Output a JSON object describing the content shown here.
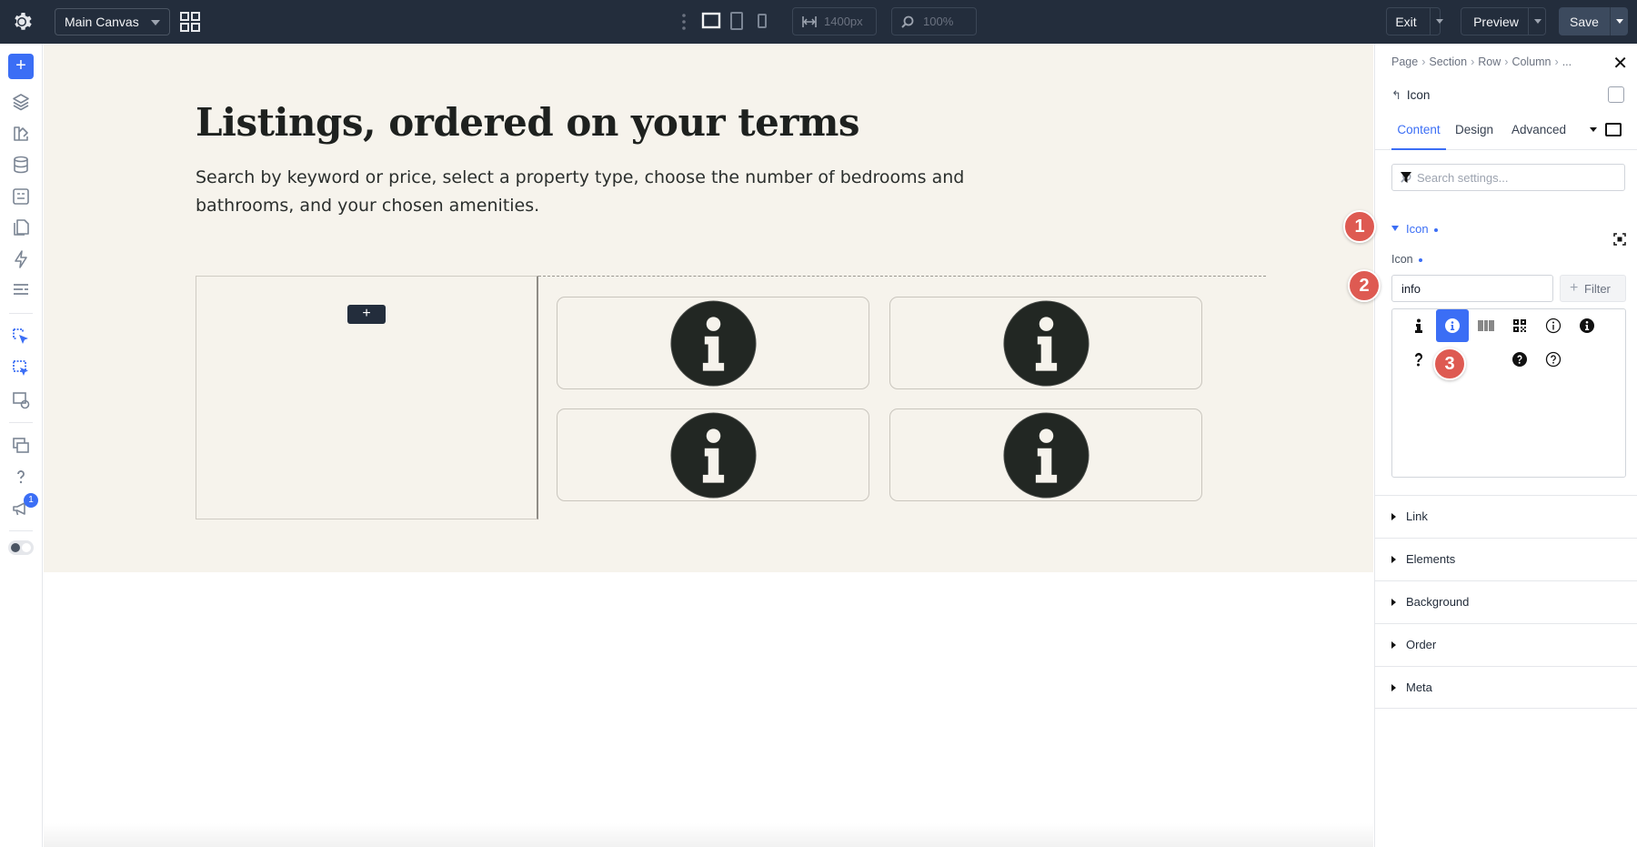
{
  "topbar": {
    "canvas_select": "Main Canvas",
    "width_value": "1400px",
    "zoom_value": "100%",
    "exit_label": "Exit",
    "preview_label": "Preview",
    "save_label": "Save"
  },
  "rail": {
    "add_label": "+",
    "notification_count": "1"
  },
  "canvas": {
    "heading": "Listings, ordered on your terms",
    "subtext": "Search by keyword or price, select a property type, choose the number of bedrooms and bathrooms, and your chosen amenities.",
    "add_label": "+",
    "card_icons": [
      "info-icon",
      "info-icon",
      "info-icon",
      "info-icon"
    ]
  },
  "panel": {
    "breadcrumb": [
      "Page",
      "Section",
      "Row",
      "Column",
      "..."
    ],
    "module_title": "Icon",
    "tabs": [
      "Content",
      "Design",
      "Advanced"
    ],
    "active_tab": "Content",
    "search_placeholder": "Search settings...",
    "open_section": "Icon",
    "field_label": "Icon",
    "field_value": "info",
    "filter_label": "Filter",
    "icon_results": [
      "info-icon",
      "info-circle-icon",
      "barcode-icon",
      "qrcode-icon",
      "info-outline-icon",
      "info-solid-icon",
      "question-icon",
      "question-circle-solid-icon",
      "question-circle-outline-icon"
    ],
    "selected_icon": "info-circle-icon",
    "sections": [
      "Link",
      "Elements",
      "Background",
      "Order",
      "Meta"
    ]
  },
  "annotations": [
    "1",
    "2",
    "3"
  ],
  "colors": {
    "topbar_bg": "#232d3c",
    "accent": "#3b6ef5",
    "canvas_bg": "#f6f3ec",
    "annotation": "#de5a52",
    "icon_disc": "#222723"
  }
}
